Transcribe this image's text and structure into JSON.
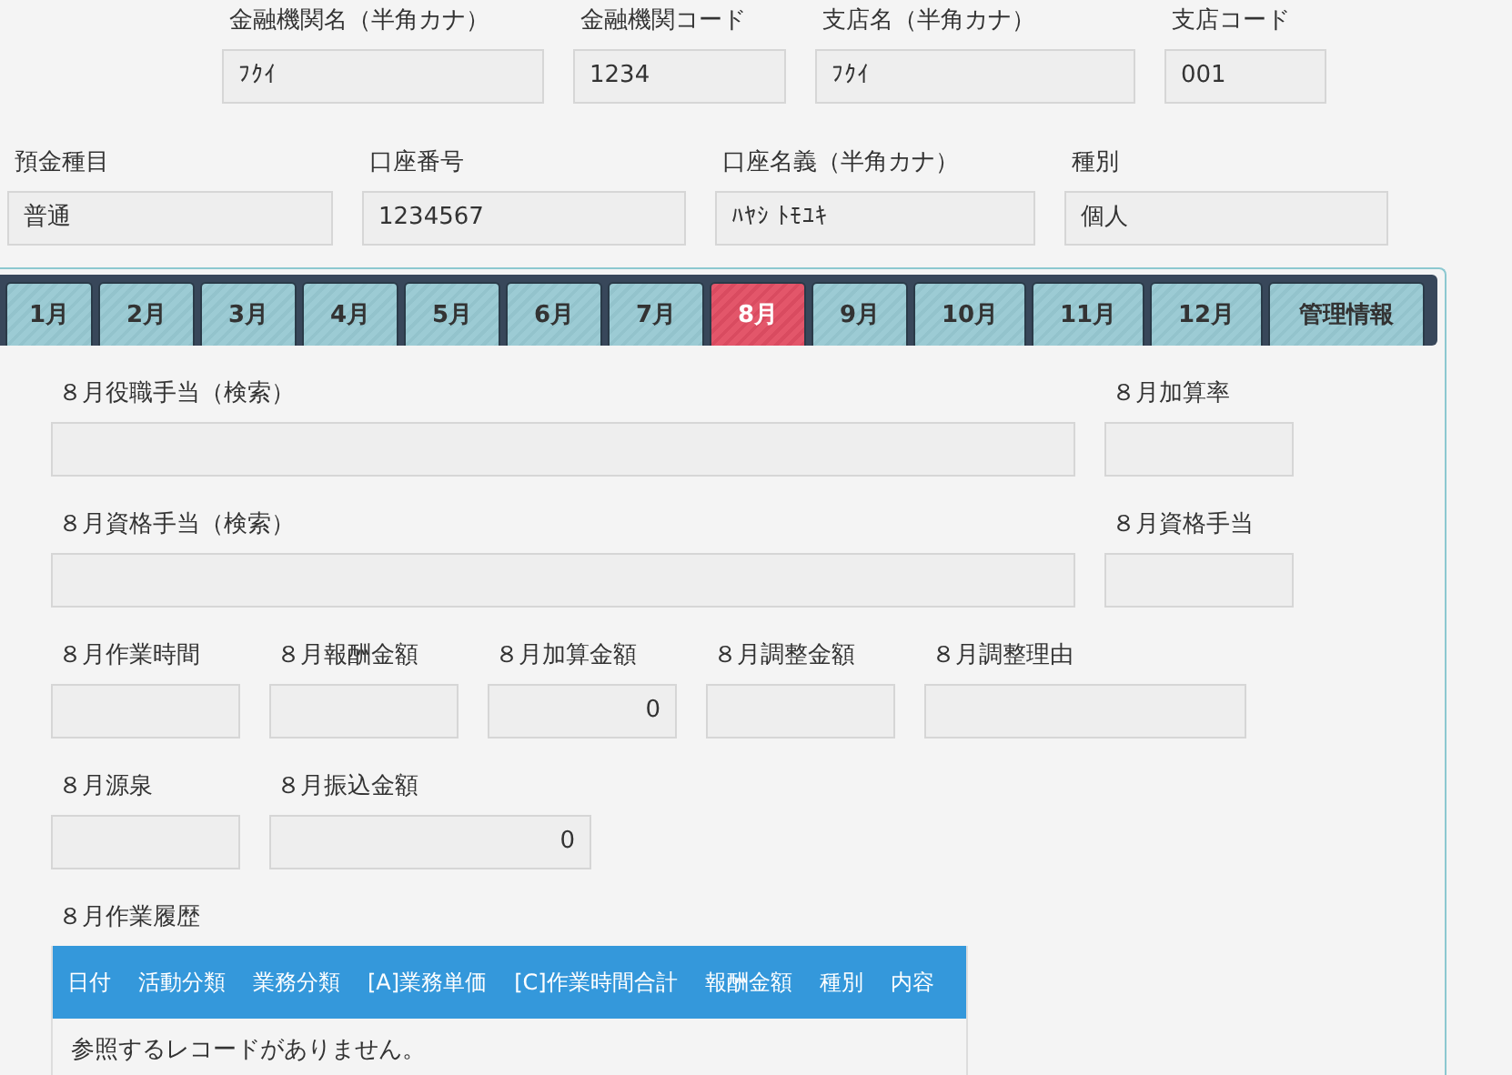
{
  "bank_row": [
    {
      "label": "金融機関名（半角カナ）",
      "value": "ﾌｸｲ"
    },
    {
      "label": "金融機関コード",
      "value": "1234"
    },
    {
      "label": "支店名（半角カナ）",
      "value": "ﾌｸｲ"
    },
    {
      "label": "支店コード",
      "value": "001"
    }
  ],
  "account_row": [
    {
      "label": "預金種目",
      "value": "普通"
    },
    {
      "label": "口座番号",
      "value": "1234567"
    },
    {
      "label": "口座名義（半角カナ）",
      "value": "ﾊﾔｼ ﾄﾓﾕｷ"
    },
    {
      "label": "種別",
      "value": "個人"
    }
  ],
  "tabs": [
    {
      "label": "1月",
      "selected": false
    },
    {
      "label": "2月",
      "selected": false
    },
    {
      "label": "3月",
      "selected": false
    },
    {
      "label": "4月",
      "selected": false
    },
    {
      "label": "5月",
      "selected": false
    },
    {
      "label": "6月",
      "selected": false
    },
    {
      "label": "7月",
      "selected": false
    },
    {
      "label": "8月",
      "selected": true
    },
    {
      "label": "9月",
      "selected": false
    },
    {
      "label": "10月",
      "selected": false
    },
    {
      "label": "11月",
      "selected": false
    },
    {
      "label": "12月",
      "selected": false
    },
    {
      "label": "管理情報",
      "selected": false
    }
  ],
  "form_rows": [
    [
      {
        "label": "８月役職手当（検索）"
      },
      {
        "label": "８月加算率"
      }
    ],
    [
      {
        "label": "８月資格手当（検索）"
      },
      {
        "label": "８月資格手当"
      }
    ],
    [
      {
        "label": "８月作業時間"
      },
      {
        "label": "８月報酬金額"
      },
      {
        "label": "８月加算金額",
        "value": "0"
      },
      {
        "label": "８月調整金額"
      },
      {
        "label": "８月調整理由"
      }
    ],
    [
      {
        "label": "８月源泉"
      },
      {
        "label": "８月振込金額",
        "value": "0"
      }
    ]
  ],
  "history": {
    "label": "８月作業履歴",
    "columns": [
      "日付",
      "活動分類",
      "業務分類",
      "[A]業務単価",
      "[C]作業時間合計",
      "報酬金額",
      "種別",
      "内容"
    ],
    "empty_message": "参照するレコードがありません。"
  }
}
